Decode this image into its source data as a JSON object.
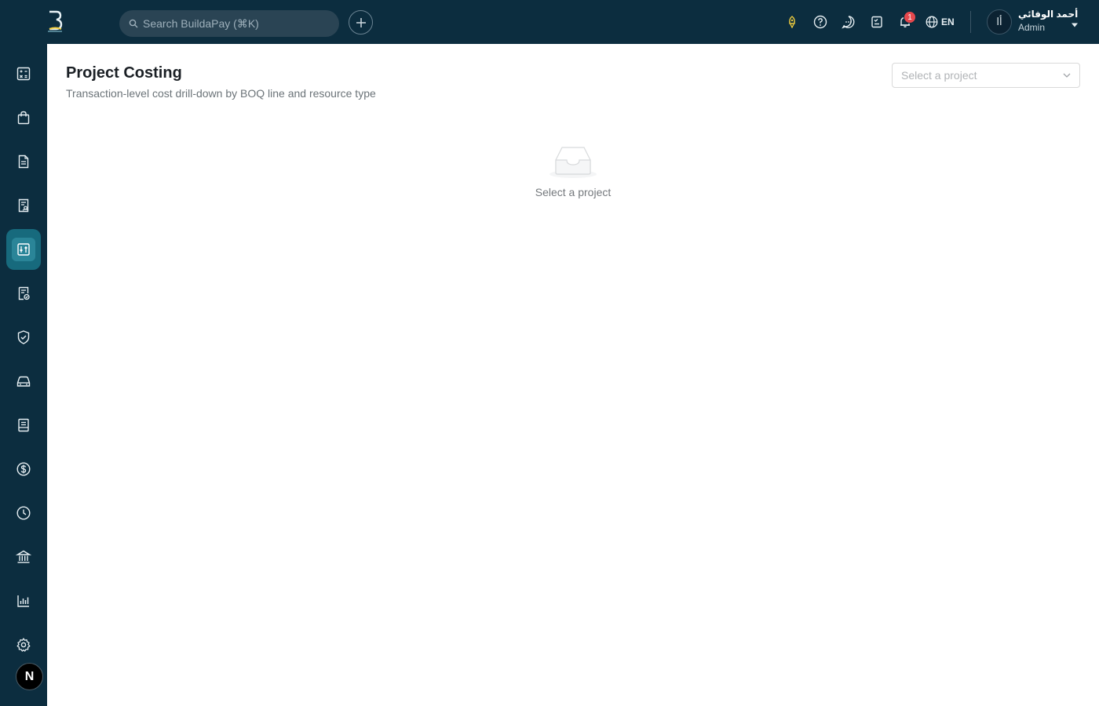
{
  "header": {
    "search_placeholder": "Search BuildaPay (⌘K)",
    "notification_count": "1",
    "language": "EN",
    "user": {
      "avatar_initial": "أا",
      "name": "أحمد الوفائي",
      "role": "Admin"
    }
  },
  "sidebar": {
    "user_badge": "N",
    "items": [
      {
        "icon": "calculator-icon"
      },
      {
        "icon": "shopping-bag-icon"
      },
      {
        "icon": "document-icon"
      },
      {
        "icon": "contract-icon"
      },
      {
        "icon": "costing-icon",
        "active": true
      },
      {
        "icon": "approval-doc-icon"
      },
      {
        "icon": "shield-check-icon"
      },
      {
        "icon": "car-icon"
      },
      {
        "icon": "receipt-icon"
      },
      {
        "icon": "dollar-icon"
      },
      {
        "icon": "clock-icon"
      },
      {
        "icon": "bank-icon"
      },
      {
        "icon": "bar-chart-icon"
      },
      {
        "icon": "settings-icon"
      }
    ]
  },
  "main": {
    "title": "Project Costing",
    "subtitle": "Transaction-level cost drill-down by BOQ line and resource type",
    "project_select_placeholder": "Select a project",
    "empty_state_text": "Select a project"
  },
  "colors": {
    "topbar_bg": "#0c2d3f",
    "active_nav": "#176a7d",
    "badge": "#e5484d"
  }
}
